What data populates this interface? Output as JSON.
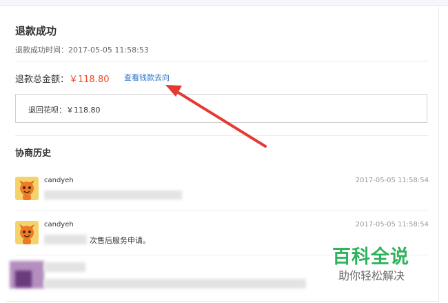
{
  "refund": {
    "title": "退款成功",
    "success_time_label": "退款成功时间：2017-05-05 11:58:53",
    "total_label": "退款总金额：",
    "total_value": "￥118.80",
    "track_link": "查看钱款去向",
    "returned_label": "退回花呗：",
    "returned_value": "￥118.80"
  },
  "history": {
    "title": "协商历史",
    "entries": [
      {
        "user": "candyeh",
        "time": "2017-05-05 11:58:54",
        "message": ""
      },
      {
        "user": "candyeh",
        "time": "2017-05-05 11:58:54",
        "message": "次售后服务申请。"
      }
    ]
  },
  "watermark": {
    "title": "百科全说",
    "subtitle": "助你轻松解决"
  },
  "colors": {
    "accent_red": "#f04a22",
    "link_blue": "#2b74c7",
    "watermark_green": "#2fb35c",
    "annotation_arrow": "#e53935"
  }
}
